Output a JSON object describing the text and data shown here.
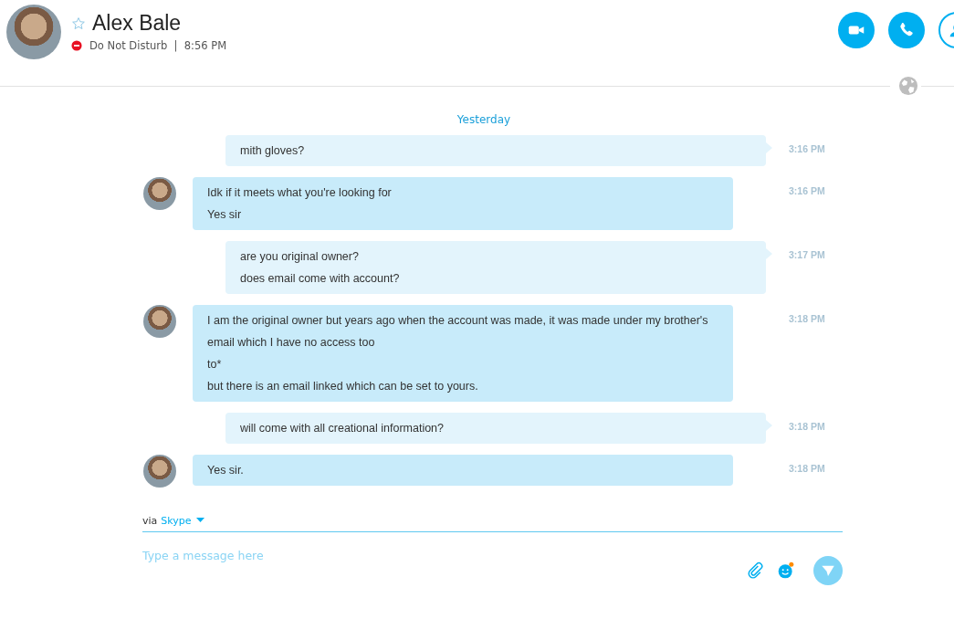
{
  "contact": {
    "name": "Alex Bale",
    "status": "Do Not Disturb",
    "divider": "|",
    "local_time": "8:56 PM",
    "favorite": false
  },
  "date_separator": "Yesterday",
  "messages": [
    {
      "kind": "separator"
    },
    {
      "kind": "outgoing",
      "lines": [
        "mith gloves?"
      ],
      "time": "3:16 PM"
    },
    {
      "kind": "incoming",
      "lines": [
        "Idk if it meets what you're looking for",
        "Yes sir"
      ],
      "time": "3:16 PM"
    },
    {
      "kind": "outgoing",
      "lines": [
        "are you original owner?",
        "does email come with account?"
      ],
      "time": "3:17 PM"
    },
    {
      "kind": "incoming",
      "lines": [
        "I am the original owner but years ago when the account was made, it was made under my brother's email which I have no access too",
        "to*",
        "but there is an email linked which can be set to yours."
      ],
      "time": "3:18 PM"
    },
    {
      "kind": "outgoing",
      "lines": [
        "will come with all creational information?"
      ],
      "time": "3:18 PM"
    },
    {
      "kind": "incoming",
      "lines": [
        "Yes sir."
      ],
      "time": "3:18 PM"
    }
  ],
  "compose": {
    "via_label": "via",
    "via_service": "Skype",
    "placeholder": "Type a message here"
  }
}
